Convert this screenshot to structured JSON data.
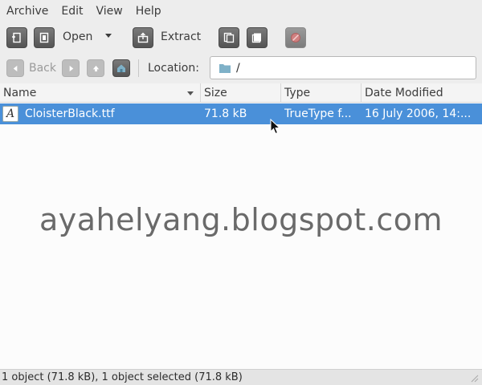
{
  "menubar": {
    "items": [
      "Archive",
      "Edit",
      "View",
      "Help"
    ]
  },
  "toolbar": {
    "open_label": "Open",
    "extract_label": "Extract"
  },
  "navigation": {
    "back_label": "Back",
    "location_label": "Location:",
    "location_value": "/"
  },
  "file_list": {
    "columns": [
      "Name",
      "Size",
      "Type",
      "Date Modified"
    ],
    "rows": [
      {
        "name": "CloisterBlack.ttf",
        "size": "71.8 kB",
        "type": "TrueType f...",
        "date_modified": "16 July 2006, 14:..."
      }
    ]
  },
  "watermark": "ayahelyang.blogspot.com",
  "status": "1 object (71.8 kB), 1 object selected (71.8 kB)",
  "colors": {
    "selection": "#4a90d9",
    "folder": "#7fb1c8"
  }
}
